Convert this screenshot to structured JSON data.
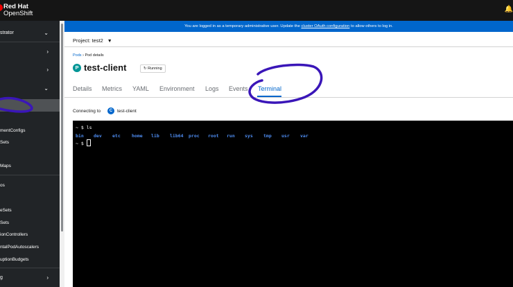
{
  "brand": {
    "line1": "Red Hat",
    "line2": "OpenShift"
  },
  "sidebar": {
    "perspective": "strator",
    "items": [
      {
        "label": "mentConfigs"
      },
      {
        "label": "Sets"
      },
      {
        "label": "Maps"
      },
      {
        "label": "os"
      },
      {
        "label": "eSets"
      },
      {
        "label": "Sets"
      },
      {
        "label": "ionControllers"
      },
      {
        "label": "ntalPodAutoscalers"
      },
      {
        "label": "uptionBudgets"
      },
      {
        "label": "g"
      }
    ]
  },
  "banner": {
    "text_before": "You are logged in as a temporary administrative user. Update the",
    "link": "cluster OAuth configuration",
    "text_after": "to allow others to log in."
  },
  "project": {
    "label": "Project: test2"
  },
  "breadcrumb": {
    "root": "Pods",
    "current": "Pod details"
  },
  "pod": {
    "badge": "P",
    "name": "test-client",
    "status": "Running"
  },
  "tabs": [
    "Details",
    "Metrics",
    "YAML",
    "Environment",
    "Logs",
    "Events",
    "Terminal"
  ],
  "connecting": {
    "label": "Connecting to",
    "badge": "C",
    "container": "test-client"
  },
  "terminal": {
    "line1": "~ $ ls",
    "dirs": [
      "bin",
      "dev",
      "etc",
      "home",
      "lib",
      "lib64",
      "proc",
      "root",
      "run",
      "sys",
      "tmp",
      "usr",
      "var"
    ],
    "prompt": "~ $ "
  },
  "colors": {
    "accent": "#0066cc",
    "annotation": "#3a16b8",
    "terminal_dir": "#4e8cf0"
  }
}
